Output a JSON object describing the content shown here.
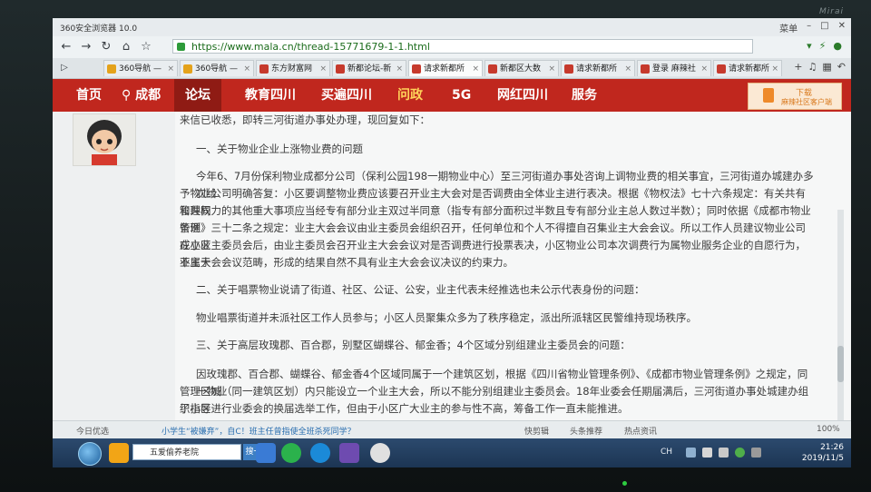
{
  "brand": "Mirai",
  "window": {
    "title": "360安全浏览器 10.0",
    "menu": "菜单"
  },
  "address": {
    "url": "https://www.mala.cn/thread-15771679-1-1.html"
  },
  "tabs": [
    {
      "label": "360导航 — ",
      "active": false
    },
    {
      "label": "360导航 — ",
      "active": false
    },
    {
      "label": "东方财富网",
      "active": false
    },
    {
      "label": "新都论坛-新",
      "active": false
    },
    {
      "label": "请求新都所",
      "active": true
    },
    {
      "label": "新都区大数",
      "active": false
    },
    {
      "label": "请求新都所",
      "active": false
    },
    {
      "label": "登录 麻辣社",
      "active": false
    },
    {
      "label": "请求新都所",
      "active": false
    }
  ],
  "site_nav": {
    "items": [
      "首页",
      "成都",
      "论坛",
      "教育四川",
      "买遍四川",
      "问政",
      "5G",
      "网红四川",
      "服务"
    ],
    "selected": "论坛",
    "download": {
      "title": "下载",
      "subtitle": "麻辣社区客户端"
    }
  },
  "post": {
    "p0": "来信已收悉，即转三河街道办事处办理，现回复如下：",
    "h1": "一、关于物业企业上涨物业费的问题",
    "para1": [
      "今年6、7月份保利物业成都分公司（保利公园198一期物业中心）至三河街道办事处咨询上调物业费的相关事宜，三河街道办城建办多次给",
      "予物业公司明确答复：小区要调整物业费应该要召开业主大会对是否调费由全体业主进行表决。根据《物权法》七十六条规定：有关共有和共同",
      "管理权力的其他重大事项应当经专有部分业主双过半同意（指专有部分面积过半数且专有部分业主总人数过半数）；同时依据《成都市物业管理",
      "条例》三十二条之规定：业主大会会议由业主委员会组织召开，任何单位和个人不得擅自召集业主大会会议。所以工作人员建议物业公司在小区",
      "成立业主委员会后，由业主委员会召开业主大会会议对是否调费进行投票表决，小区物业公司本次调费行为属物业服务企业的自愿行为，不属于",
      "业主大会会议范畴，形成的结果自然不具有业主大会会议决议的约束力。"
    ],
    "h2": "二、关于唱票物业说请了街道、社区、公证、公安，业主代表未经推选也未公示代表身份的问题：",
    "p2": "物业唱票街道并未派社区工作人员参与；小区人员聚集众多为了秩序稳定，派出所派辖区民警维持现场秩序。",
    "h3": "三、关于高层玫瑰郡、百合郡，别墅区蝴蝶谷、郁金香；4个区域分别组建业主委员会的问题：",
    "para3": [
      "因玫瑰郡、百合郡、蝴蝶谷、郁金香4个区域同属于一个建筑区划，根据《四川省物业管理条例》、《成都市物业管理条例》之规定，同一物业",
      "管理区域（同一建筑区划）内只能设立一个业主大会，所以不能分别组建业主委员会。18年业委会任期届满后，三河街道办事处城建办组织指导",
      "了小区进行业委会的换届选举工作，但由于小区广大业主的参与性不高，筹备工作一直未能推进。"
    ]
  },
  "status": {
    "left": "今日优选",
    "news": "小学生“被嫌弃”，自C！班主任曾指使全班杀死同学？",
    "mid1": "快剪辑",
    "mid2": "头条推荐",
    "mid3": "热点资讯",
    "zoom": "100%"
  },
  "taskbar": {
    "search_placeholder": "五爱偷养老院",
    "search_button": "搜一下",
    "tray_lang": "CH",
    "time": "21:26",
    "date": "2019/11/5"
  }
}
